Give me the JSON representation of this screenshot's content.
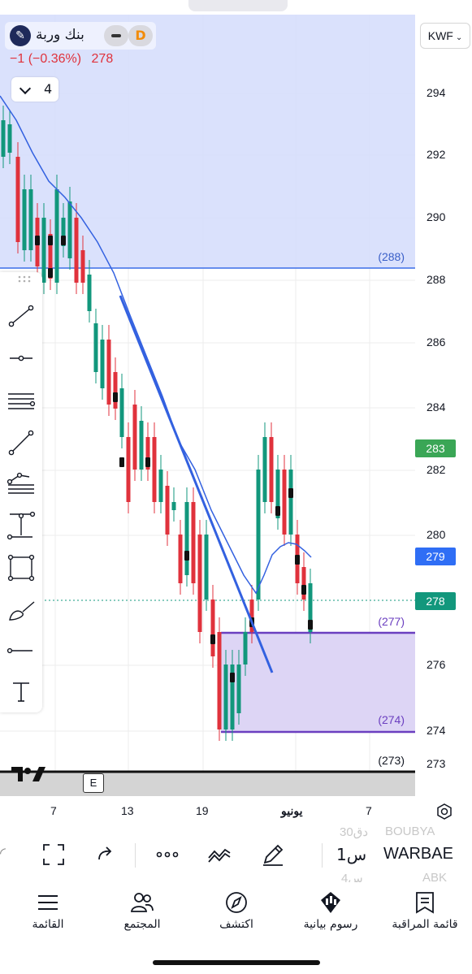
{
  "symbol": {
    "name": "بنك وربة",
    "badge": "D",
    "change": "−1 (−0.36%)",
    "last": "278"
  },
  "interval_selector": {
    "value": "4"
  },
  "currency": "KWF",
  "price_axis": {
    "ticks": [
      "294",
      "292",
      "290",
      "288",
      "286",
      "284",
      "282",
      "280",
      "276",
      "274",
      "273"
    ],
    "tags": [
      {
        "label": "283",
        "color": "#3aa656"
      },
      {
        "label": "279",
        "color": "#2f6ef5"
      },
      {
        "label": "278",
        "color": "#12977c"
      }
    ]
  },
  "zone_labels": {
    "upper": "(288)",
    "top_box": "(277)",
    "bottom_box": "(274)",
    "lowest": "(273)"
  },
  "time_axis": [
    "7",
    "13",
    "19",
    "يونيو",
    "7"
  ],
  "e_badge": "E",
  "chart_toolbar": {
    "interval": "1س",
    "ticker": "WARBAE",
    "watch_above": {
      "ticker": "BOUBYA",
      "interval": "30دق"
    },
    "watch_below": {
      "ticker": "ABK",
      "interval": "4س"
    }
  },
  "bottom_nav": [
    {
      "label": "قائمة المراقبة",
      "icon": "watchlist-icon"
    },
    {
      "label": "رسوم بيانية",
      "icon": "charts-icon"
    },
    {
      "label": "اكتشف",
      "icon": "explore-icon"
    },
    {
      "label": "المجتمع",
      "icon": "community-icon"
    },
    {
      "label": "القائمة",
      "icon": "menu-icon"
    }
  ],
  "colors": {
    "bull": "#12977c",
    "bear": "#e0323c",
    "ma": "#3361e0",
    "upper_zone": "#d6defc",
    "box": "#ddd5f5",
    "box_line": "#6b3fc0"
  }
}
